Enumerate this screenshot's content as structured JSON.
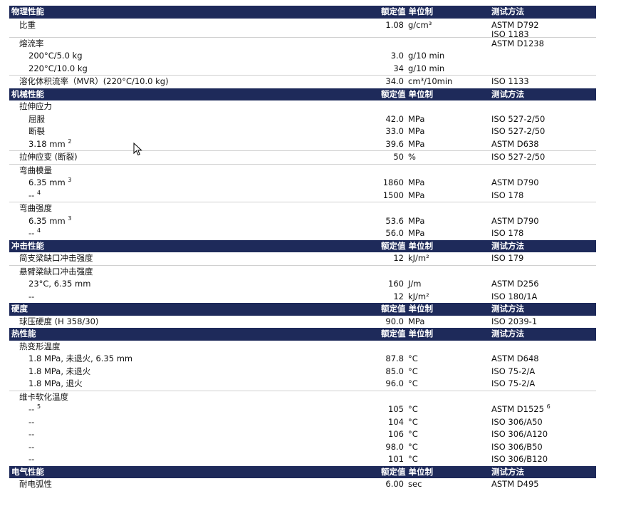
{
  "sections": [
    {
      "title": "物理性能",
      "value_header": "额定值 单位制",
      "method_header": "测试方法",
      "rows": [
        {
          "name": "比重",
          "level": 1,
          "value": "1.08",
          "unit": "g/cm³",
          "method": "ASTM D792",
          "method2": "ISO 1183",
          "tall": true
        },
        {
          "name": "熔流率",
          "level": 1,
          "value": "",
          "unit": "",
          "method": "ASTM D1238",
          "sep": true
        },
        {
          "name": "200°C/5.0 kg",
          "level": 2,
          "value": "3.0",
          "unit": "g/10 min",
          "method": ""
        },
        {
          "name": "220°C/10.0 kg",
          "level": 2,
          "value": "34",
          "unit": "g/10 min",
          "method": ""
        },
        {
          "name": "溶化体积流率（MVR）(220°C/10.0 kg)",
          "level": 1,
          "value": "34.0",
          "unit": "cm³/10min",
          "method": "ISO 1133",
          "sep": true
        }
      ]
    },
    {
      "title": "机械性能",
      "value_header": "额定值 单位制",
      "method_header": "测试方法",
      "rows": [
        {
          "name": "拉伸应力",
          "level": 1,
          "value": "",
          "unit": "",
          "method": ""
        },
        {
          "name": "屈服",
          "level": 2,
          "value": "42.0",
          "unit": "MPa",
          "method": "ISO 527-2/50"
        },
        {
          "name": "断裂",
          "level": 2,
          "value": "33.0",
          "unit": "MPa",
          "method": "ISO 527-2/50"
        },
        {
          "name": "3.18 mm",
          "sup": "2",
          "level": 2,
          "value": "39.6",
          "unit": "MPa",
          "method": "ASTM D638"
        },
        {
          "name": "拉伸应变 (断裂)",
          "level": 1,
          "value": "50",
          "unit": "%",
          "method": "ISO 527-2/50",
          "sep": true
        },
        {
          "name": "弯曲模量",
          "level": 1,
          "value": "",
          "unit": "",
          "method": "",
          "sep": true
        },
        {
          "name": "6.35 mm",
          "sup": "3",
          "level": 2,
          "value": "1860",
          "unit": "MPa",
          "method": "ASTM D790"
        },
        {
          "name": "--",
          "sup": "4",
          "level": 2,
          "value": "1500",
          "unit": "MPa",
          "method": "ISO 178"
        },
        {
          "name": "弯曲强度",
          "level": 1,
          "value": "",
          "unit": "",
          "method": "",
          "sep": true
        },
        {
          "name": "6.35 mm",
          "sup": "3",
          "level": 2,
          "value": "53.6",
          "unit": "MPa",
          "method": "ASTM D790"
        },
        {
          "name": "--",
          "sup": "4",
          "level": 2,
          "value": "56.0",
          "unit": "MPa",
          "method": "ISO 178"
        }
      ]
    },
    {
      "title": "冲击性能",
      "value_header": "额定值 单位制",
      "method_header": "测试方法",
      "rows": [
        {
          "name": "简支梁缺口冲击强度",
          "level": 1,
          "value": "12",
          "unit": "kJ/m²",
          "method": "ISO 179"
        },
        {
          "name": "悬臂梁缺口冲击强度",
          "level": 1,
          "value": "",
          "unit": "",
          "method": "",
          "sep": true
        },
        {
          "name": "23°C, 6.35 mm",
          "level": 2,
          "value": "160",
          "unit": "J/m",
          "method": "ASTM D256"
        },
        {
          "name": "--",
          "level": 2,
          "value": "12",
          "unit": "kJ/m²",
          "method": "ISO 180/1A"
        }
      ]
    },
    {
      "title": "硬度",
      "value_header": "额定值 单位制",
      "method_header": "测试方法",
      "rows": [
        {
          "name": "球压硬度 (H 358/30)",
          "level": 1,
          "value": "90.0",
          "unit": "MPa",
          "method": "ISO 2039-1"
        }
      ]
    },
    {
      "title": "热性能",
      "value_header": "额定值 单位制",
      "method_header": "测试方法",
      "rows": [
        {
          "name": "热变形温度",
          "level": 1,
          "value": "",
          "unit": "",
          "method": ""
        },
        {
          "name": "1.8 MPa, 未退火, 6.35 mm",
          "level": 2,
          "value": "87.8",
          "unit": "°C",
          "method": "ASTM D648"
        },
        {
          "name": "1.8 MPa, 未退火",
          "level": 2,
          "value": "85.0",
          "unit": "°C",
          "method": "ISO 75-2/A"
        },
        {
          "name": "1.8 MPa, 退火",
          "level": 2,
          "value": "96.0",
          "unit": "°C",
          "method": "ISO 75-2/A"
        },
        {
          "name": "维卡软化温度",
          "level": 1,
          "value": "",
          "unit": "",
          "method": "",
          "sep": true
        },
        {
          "name": "--",
          "sup": "5",
          "level": 2,
          "value": "105",
          "unit": "°C",
          "method": "ASTM D1525",
          "method_sup": "6"
        },
        {
          "name": "--",
          "level": 2,
          "value": "104",
          "unit": "°C",
          "method": "ISO 306/A50"
        },
        {
          "name": "--",
          "level": 2,
          "value": "106",
          "unit": "°C",
          "method": "ISO 306/A120"
        },
        {
          "name": "--",
          "level": 2,
          "value": "98.0",
          "unit": "°C",
          "method": "ISO 306/B50"
        },
        {
          "name": "--",
          "level": 2,
          "value": "101",
          "unit": "°C",
          "method": "ISO 306/B120"
        }
      ]
    },
    {
      "title": "电气性能",
      "value_header": "额定值 单位制",
      "method_header": "测试方法",
      "rows": [
        {
          "name": "耐电弧性",
          "level": 1,
          "value": "6.00",
          "unit": "sec",
          "method": "ASTM D495"
        }
      ]
    }
  ],
  "colors": {
    "header_bg": "#1e2a5a",
    "header_text": "#ffffff",
    "separator": "#d0d0d0"
  },
  "icons": {
    "cursor": "arrow-pointer-icon"
  }
}
